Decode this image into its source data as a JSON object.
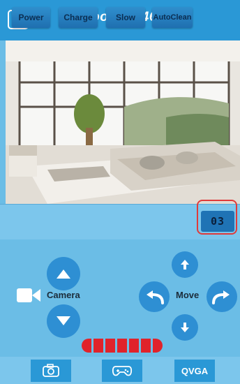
{
  "header": {
    "title": "doorcam46",
    "back_icon": "back-arrow-icon"
  },
  "toolbar": {
    "buttons": [
      {
        "label": "Power"
      },
      {
        "label": "Charge"
      },
      {
        "label": "Slow"
      },
      {
        "label": "AutoClean"
      }
    ],
    "dial_label": "03"
  },
  "controls": {
    "camera_label": "Camera",
    "move_label": "Move"
  },
  "battery": {
    "level_segments_filled": 7,
    "color": "#e0232b"
  },
  "bottom": {
    "snapshot_icon": "camera-icon",
    "gamepad_icon": "gamepad-icon",
    "resolution_label": "QVGA"
  },
  "colors": {
    "header": "#2a98d6",
    "background": "#6bbde6",
    "accent": "#2e8fd3",
    "highlight": "#e03a3a"
  }
}
